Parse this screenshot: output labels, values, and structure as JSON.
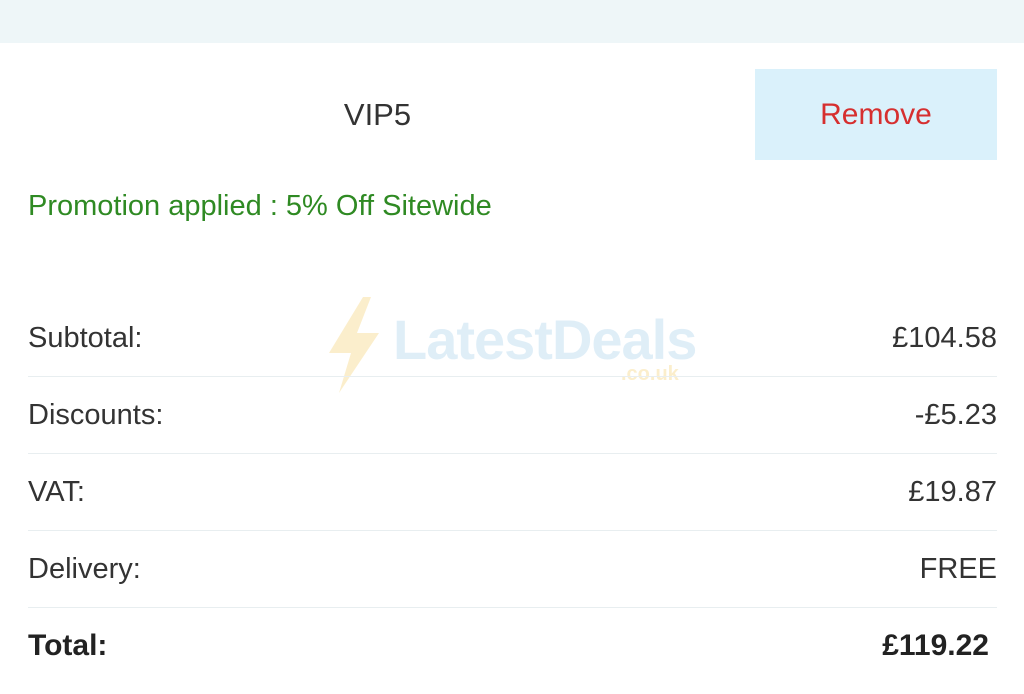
{
  "promo": {
    "code": "VIP5",
    "remove_label": "Remove",
    "status_text": "Promotion applied : 5% Off Sitewide"
  },
  "summary": {
    "rows": [
      {
        "label": "Subtotal:",
        "value": "£104.58"
      },
      {
        "label": "Discounts:",
        "value": "-£5.23"
      },
      {
        "label": "VAT:",
        "value": "£19.87"
      },
      {
        "label": "Delivery:",
        "value": "FREE"
      }
    ],
    "total": {
      "label": "Total:",
      "value": "£119.22"
    }
  },
  "watermark": {
    "brand": "LatestDeals",
    "domain": ".co.uk",
    "icon": "lightning-bolt-icon"
  },
  "colors": {
    "remove_text": "#d62f2f",
    "remove_bg": "#daf1fb",
    "promo_status": "#2f8a23"
  }
}
